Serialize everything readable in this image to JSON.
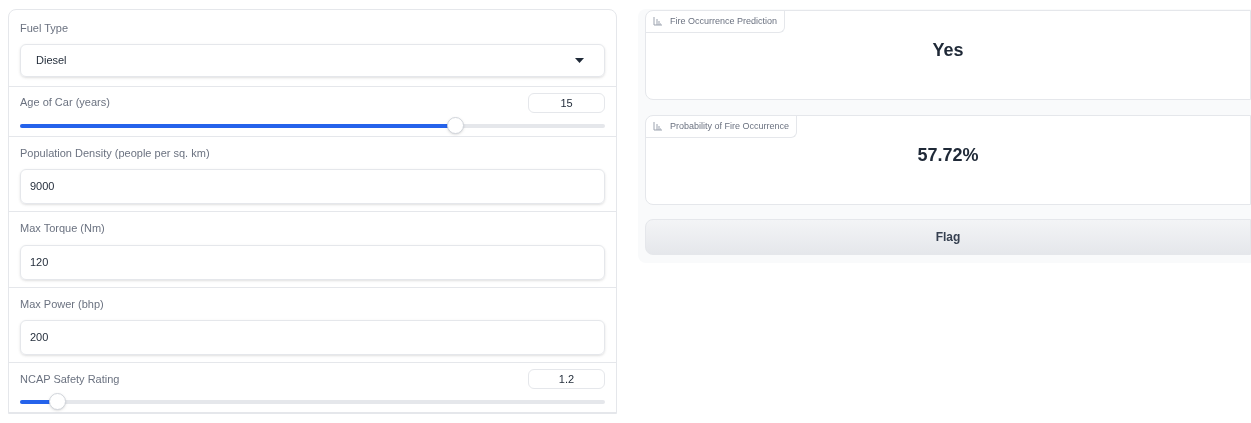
{
  "inputs": [
    {
      "kind": "dropdown",
      "label": "Fuel Type",
      "value": "Diesel"
    },
    {
      "kind": "slider",
      "label": "Age of Car (years)",
      "value": "15",
      "level": 0.744
    },
    {
      "kind": "number",
      "label": "Population Density (people per sq. km)",
      "value": "9000"
    },
    {
      "kind": "number",
      "label": "Max Torque (Nm)",
      "value": "120"
    },
    {
      "kind": "number",
      "label": "Max Power (bhp)",
      "value": "200"
    },
    {
      "kind": "slider",
      "label": "NCAP Safety Rating",
      "value": "1.2",
      "level": 0.063
    }
  ],
  "outputs": [
    {
      "label": "Fire Occurrence Prediction",
      "value": "Yes"
    },
    {
      "label": "Probability of Fire Occurrence",
      "value": "57.72%"
    }
  ],
  "flag_button": "Flag"
}
